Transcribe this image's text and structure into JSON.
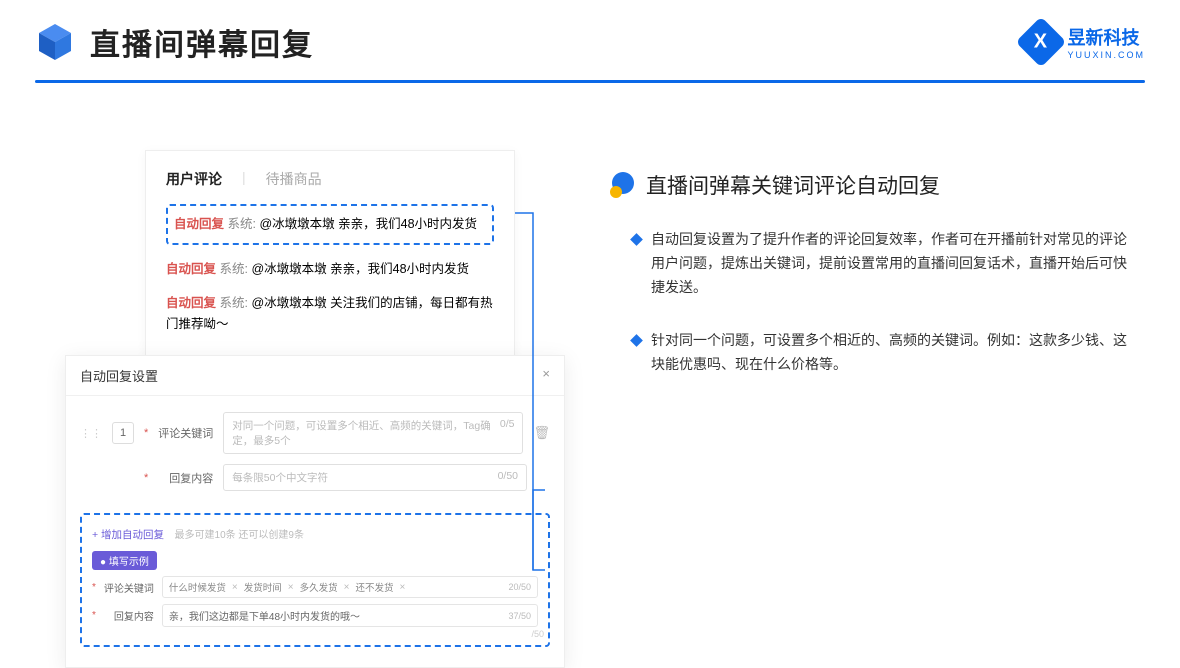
{
  "header": {
    "title": "直播间弹幕回复",
    "logo_text": "昱新科技",
    "logo_sub": "YUUXIN.COM",
    "logo_x": "X"
  },
  "comment_card": {
    "tab_active": "用户评论",
    "tab_inactive": "待播商品",
    "rows": [
      {
        "tag": "自动回复",
        "sys": "系统:",
        "text": "@冰墩墩本墩 亲亲，我们48小时内发货"
      },
      {
        "tag": "自动回复",
        "sys": "系统:",
        "text": "@冰墩墩本墩 亲亲，我们48小时内发货"
      },
      {
        "tag": "自动回复",
        "sys": "系统:",
        "text": "@冰墩墩本墩 关注我们的店铺，每日都有热门推荐呦～"
      }
    ]
  },
  "settings": {
    "title": "自动回复设置",
    "close": "×",
    "index": "1",
    "keyword_label": "评论关键词",
    "keyword_placeholder": "对同一个问题，可设置多个相近、高频的关键词，Tag确定，最多5个",
    "keyword_count": "0/5",
    "reply_label": "回复内容",
    "reply_placeholder": "每条限50个中文字符",
    "reply_count": "0/50",
    "add_link": "+ 增加自动回复",
    "add_sub": "最多可建10条 还可以创建9条",
    "example_badge": "● 填写示例",
    "ex_keyword_label": "评论关键词",
    "ex_tags": [
      "什么时候发货",
      "发货时间",
      "多久发货",
      "还不发货"
    ],
    "ex_keyword_count": "20/50",
    "ex_reply_label": "回复内容",
    "ex_reply_text": "亲，我们这边都是下单48小时内发货的哦～",
    "ex_reply_count": "37/50",
    "ghost_count": "/50"
  },
  "right": {
    "heading": "直播间弹幕关键词评论自动回复",
    "bullets": [
      "自动回复设置为了提升作者的评论回复效率，作者可在开播前针对常见的评论用户问题，提炼出关键词，提前设置常用的直播间回复话术，直播开始后可快捷发送。",
      "针对同一个问题，可设置多个相近的、高频的关键词。例如：这款多少钱、这块能优惠吗、现在什么价格等。"
    ]
  }
}
